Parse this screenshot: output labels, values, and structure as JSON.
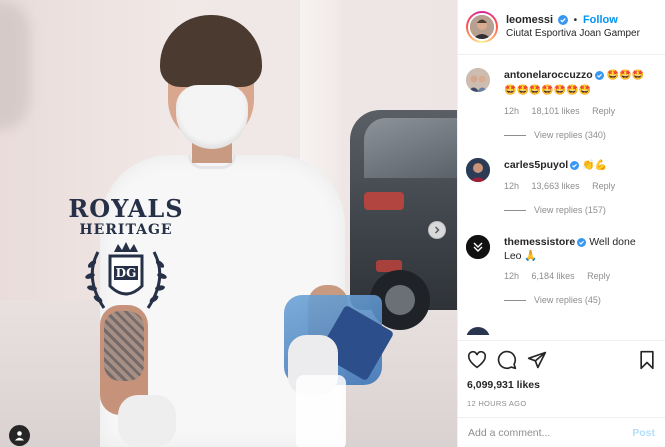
{
  "post": {
    "username": "leomessi",
    "follow_label": "Follow",
    "separator": "•",
    "location": "Ciutat Esportiva Joan Gamper",
    "shirt_text": [
      "ROYALS",
      "HERITAGE",
      "DG"
    ],
    "accent_color": "#0095f6"
  },
  "comments": [
    {
      "username": "antonelaroccuzzo",
      "text": "🤩🤩🤩🤩🤩🤩🤩🤩🤩🤩",
      "time": "12h",
      "likes": "18,101 likes",
      "reply": "Reply",
      "view_replies": "View replies (340)"
    },
    {
      "username": "carles5puyol",
      "text": "👏💪",
      "time": "12h",
      "likes": "13,663 likes",
      "reply": "Reply",
      "view_replies": "View replies (157)"
    },
    {
      "username": "themessistore",
      "text": "Well done Leo 🙏",
      "time": "12h",
      "likes": "6,184 likes",
      "reply": "Reply",
      "view_replies": "View replies (45)"
    }
  ],
  "actions": {
    "icons": [
      "heart-icon",
      "comment-icon",
      "share-icon",
      "bookmark-icon"
    ]
  },
  "likes_count": "6,099,931 likes",
  "timestamp": "12 HOURS AGO",
  "add_comment": {
    "placeholder": "Add a comment...",
    "post_label": "Post"
  }
}
